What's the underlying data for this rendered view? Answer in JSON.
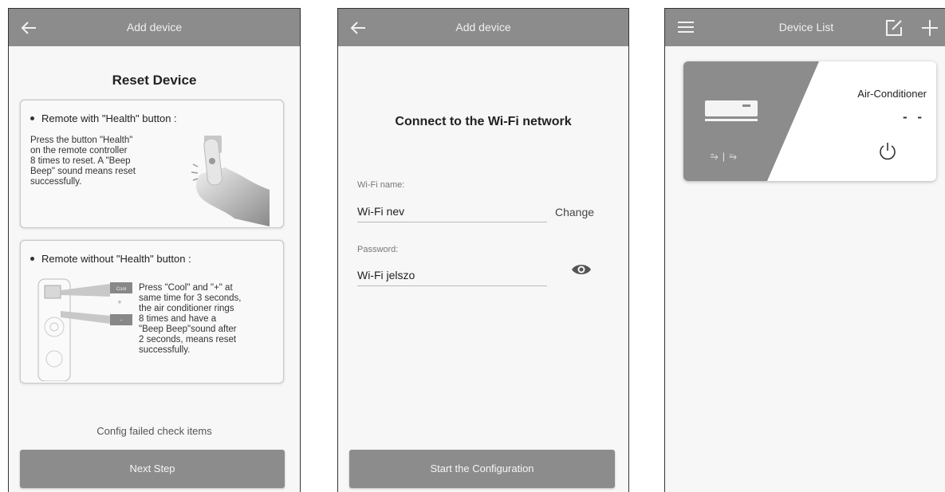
{
  "screen1": {
    "title": "Add device",
    "heading": "Reset Device",
    "card1": {
      "title": "Remote with \"Health\" button :",
      "text": "Press the button \"Health\"\non the remote controller\n8 times to reset. A \"Beep\nBeep\" sound means reset\nsuccessfully."
    },
    "card2": {
      "title": "Remote without \"Health\" button :",
      "text": "Press \"Cool\" and \"+\" at\nsame time for 3 seconds,\nthe air conditioner rings\n8 times and have a\n\"Beep Beep\"sound after\n2 seconds, means reset\nsuccessfully.",
      "remote_labels": {
        "cool": "Cool",
        "plus": "+",
        "minus": "-"
      }
    },
    "config_failed": "Config failed check items",
    "next_button": "Next Step"
  },
  "screen2": {
    "title": "Add device",
    "heading": "Connect to the Wi-Fi network",
    "wifi_name_label": "Wi-Fi name:",
    "wifi_name_value": "Wi-Fi nev",
    "change_label": "Change",
    "password_label": "Password:",
    "password_value": "Wi-Fi jelszo",
    "start_button": "Start the Configuration"
  },
  "screen3": {
    "title": "Device List",
    "device": {
      "name": "Air-Conditioner",
      "status": "- -",
      "mode_icons": "⥲ | ⥱"
    }
  },
  "icons": [
    "back-arrow-icon",
    "menu-icon",
    "edit-icon",
    "plus-icon",
    "eye-icon",
    "power-icon",
    "air-conditioner-icon"
  ],
  "colors": {
    "topbar": "#8c8c8c",
    "button": "#8c8c8c",
    "background": "#f7f7f7"
  }
}
